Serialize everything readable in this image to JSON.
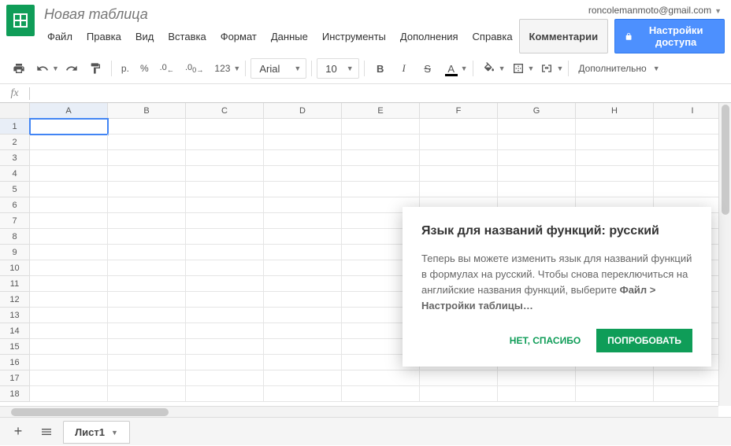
{
  "account_email": "roncolemanmoto@gmail.com",
  "doc_title": "Новая таблица",
  "menu": [
    "Файл",
    "Правка",
    "Вид",
    "Вставка",
    "Формат",
    "Данные",
    "Инструменты",
    "Дополнения",
    "Справка"
  ],
  "header_buttons": {
    "comments": "Комментарии",
    "share": "Настройки доступа"
  },
  "toolbar": {
    "currency": "р.",
    "percent": "%",
    "dec_dec": ".0",
    "dec_inc": ".00",
    "numfmt": "123",
    "font": "Arial",
    "size": "10",
    "bold": "B",
    "italic": "I",
    "strike": "S",
    "textcolor": "A",
    "more": "Дополнительно"
  },
  "fx_label": "fx",
  "columns": [
    "A",
    "B",
    "C",
    "D",
    "E",
    "F",
    "G",
    "H",
    "I"
  ],
  "rows": [
    1,
    2,
    3,
    4,
    5,
    6,
    7,
    8,
    9,
    10,
    11,
    12,
    13,
    14,
    15,
    16,
    17,
    18
  ],
  "selected_cell": "A1",
  "sheet_tab": "Лист1",
  "dialog": {
    "title": "Язык для названий функций: русский",
    "body_pre": "Теперь вы можете изменить язык для названий функций в формулах на русский. Чтобы снова переключиться на английские названия функций, выберите ",
    "body_bold": "Файл > Настройки таблицы…",
    "no": "НЕТ, СПАСИБО",
    "try": "ПОПРОБОВАТЬ"
  }
}
